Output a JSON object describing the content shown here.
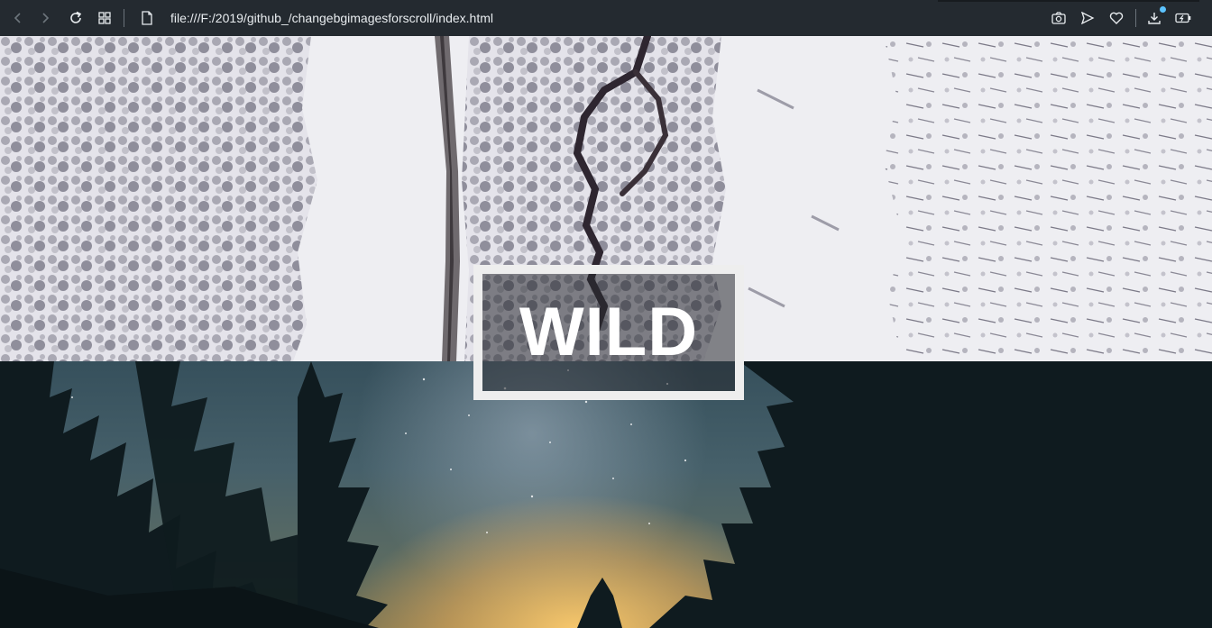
{
  "browser": {
    "url": "file:///F:/2019/github_/changebgimagesforscroll/index.html",
    "icons": {
      "back": "chevron-left-icon",
      "forward": "chevron-right-icon",
      "reload": "reload-icon",
      "tabs": "grid-icon",
      "page": "page-icon",
      "snapshot": "camera-icon",
      "send": "send-icon",
      "bookmark": "heart-icon",
      "downloads": "download-icon",
      "battery": "battery-icon"
    },
    "colors": {
      "toolbar": "#242a30",
      "accent": "#5cc3ff"
    }
  },
  "page": {
    "title": "WILD",
    "sections": [
      {
        "name": "snowy-forest-aerial",
        "kind": "image"
      },
      {
        "name": "starry-night-forest",
        "kind": "image"
      }
    ]
  }
}
